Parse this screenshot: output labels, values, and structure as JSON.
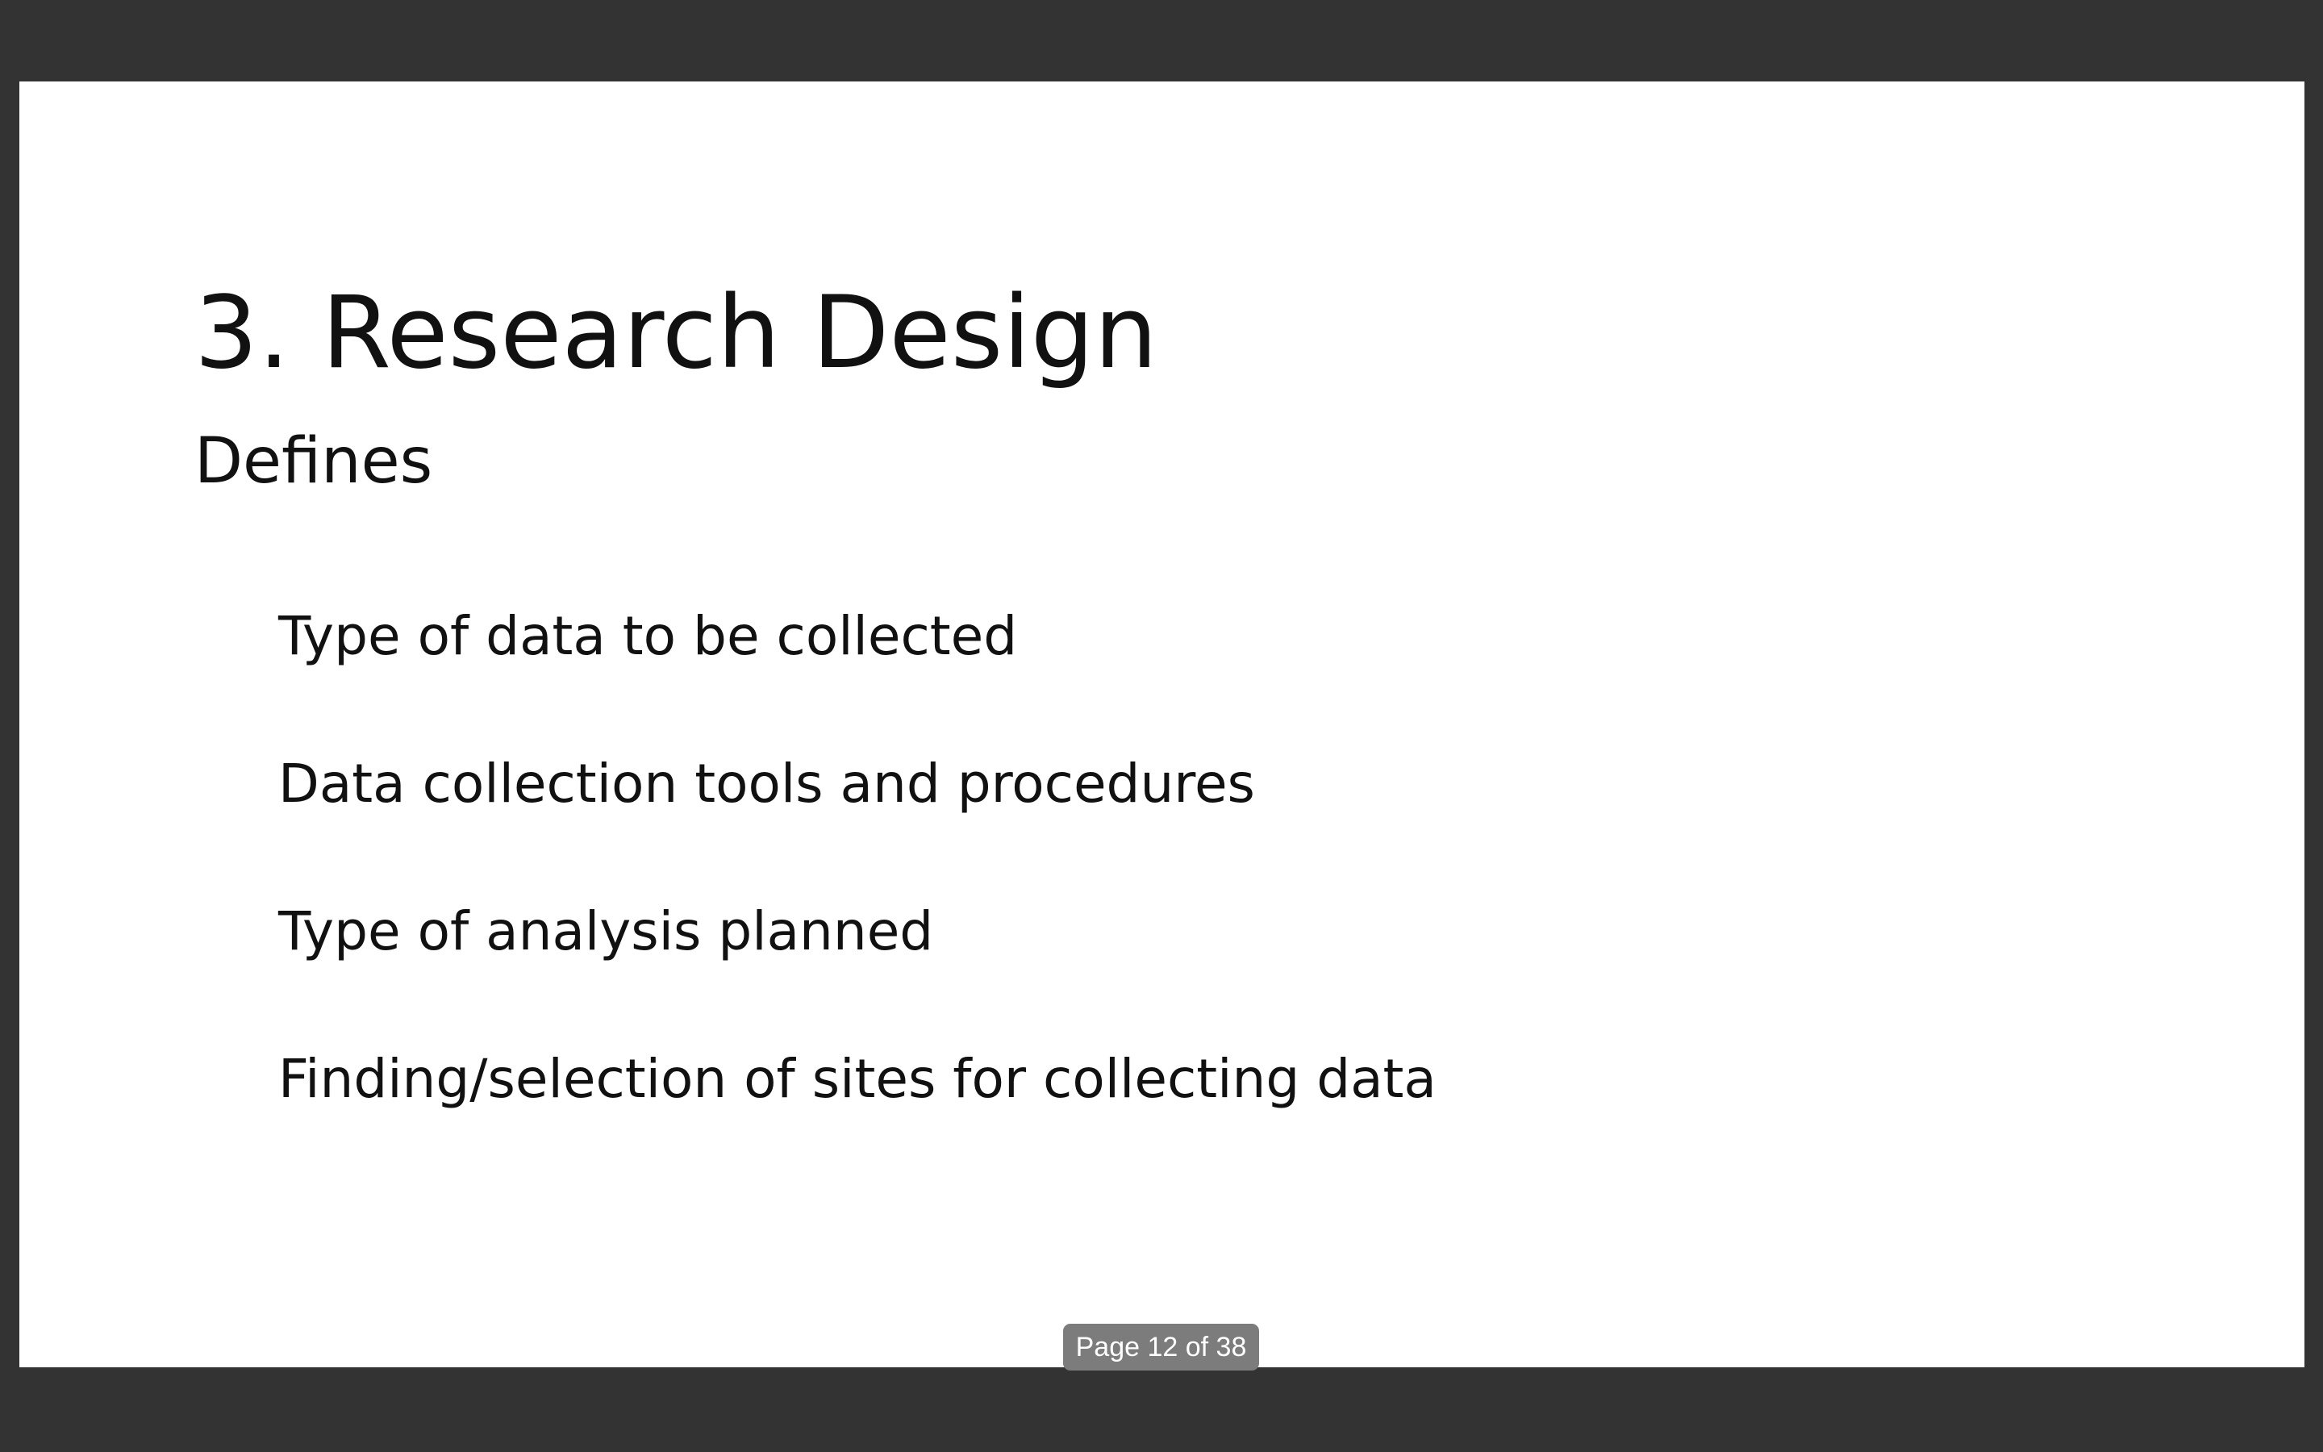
{
  "slide": {
    "title": "3. Research Design",
    "subtitle": "Defines",
    "bullets": [
      "Type of data to be collected",
      "Data collection tools and procedures",
      "Type of analysis planned",
      "Finding/selection of sites for collecting data"
    ]
  },
  "viewer": {
    "page_indicator": "Page 12 of 38"
  },
  "colors": {
    "background": "#333333",
    "slide": "#ffffff",
    "text": "#111111",
    "indicator": "#7c7c7c"
  }
}
